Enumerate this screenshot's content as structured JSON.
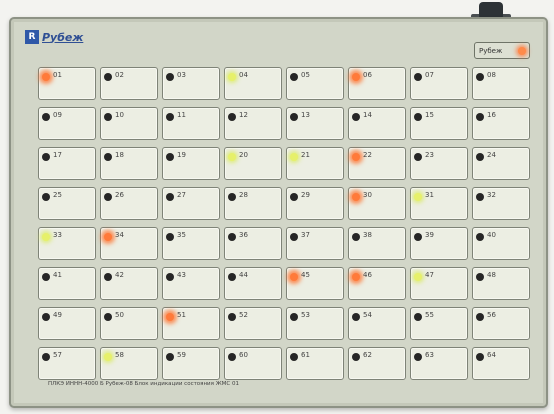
{
  "device": {
    "logo_mark": "R",
    "logo_text": "Рубеж",
    "status_label": "Рубеж",
    "footer_text": "ПЛКЭ ИННН-4000 Б Рубеж-08 Блок индикации состояния ЖМС 01"
  },
  "cells": [
    {
      "label": "01",
      "led": "orange"
    },
    {
      "label": "02",
      "led": "off"
    },
    {
      "label": "03",
      "led": "off"
    },
    {
      "label": "04",
      "led": "yellow"
    },
    {
      "label": "05",
      "led": "off"
    },
    {
      "label": "06",
      "led": "orange"
    },
    {
      "label": "07",
      "led": "off"
    },
    {
      "label": "08",
      "led": "off"
    },
    {
      "label": "09",
      "led": "off"
    },
    {
      "label": "10",
      "led": "off"
    },
    {
      "label": "11",
      "led": "off"
    },
    {
      "label": "12",
      "led": "off"
    },
    {
      "label": "13",
      "led": "off"
    },
    {
      "label": "14",
      "led": "off"
    },
    {
      "label": "15",
      "led": "off"
    },
    {
      "label": "16",
      "led": "off"
    },
    {
      "label": "17",
      "led": "off"
    },
    {
      "label": "18",
      "led": "off"
    },
    {
      "label": "19",
      "led": "off"
    },
    {
      "label": "20",
      "led": "yellow"
    },
    {
      "label": "21",
      "led": "yellow"
    },
    {
      "label": "22",
      "led": "orange"
    },
    {
      "label": "23",
      "led": "off"
    },
    {
      "label": "24",
      "led": "off"
    },
    {
      "label": "25",
      "led": "off"
    },
    {
      "label": "26",
      "led": "off"
    },
    {
      "label": "27",
      "led": "off"
    },
    {
      "label": "28",
      "led": "off"
    },
    {
      "label": "29",
      "led": "off"
    },
    {
      "label": "30",
      "led": "orange"
    },
    {
      "label": "31",
      "led": "yellow"
    },
    {
      "label": "32",
      "led": "off"
    },
    {
      "label": "33",
      "led": "yellow"
    },
    {
      "label": "34",
      "led": "orange"
    },
    {
      "label": "35",
      "led": "off"
    },
    {
      "label": "36",
      "led": "off"
    },
    {
      "label": "37",
      "led": "off"
    },
    {
      "label": "38",
      "led": "off"
    },
    {
      "label": "39",
      "led": "off"
    },
    {
      "label": "40",
      "led": "off"
    },
    {
      "label": "41",
      "led": "off"
    },
    {
      "label": "42",
      "led": "off"
    },
    {
      "label": "43",
      "led": "off"
    },
    {
      "label": "44",
      "led": "off"
    },
    {
      "label": "45",
      "led": "orange"
    },
    {
      "label": "46",
      "led": "orange"
    },
    {
      "label": "47",
      "led": "yellow"
    },
    {
      "label": "48",
      "led": "off"
    },
    {
      "label": "49",
      "led": "off"
    },
    {
      "label": "50",
      "led": "off"
    },
    {
      "label": "51",
      "led": "orange"
    },
    {
      "label": "52",
      "led": "off"
    },
    {
      "label": "53",
      "led": "off"
    },
    {
      "label": "54",
      "led": "off"
    },
    {
      "label": "55",
      "led": "off"
    },
    {
      "label": "56",
      "led": "off"
    },
    {
      "label": "57",
      "led": "off"
    },
    {
      "label": "58",
      "led": "yellow"
    },
    {
      "label": "59",
      "led": "off"
    },
    {
      "label": "60",
      "led": "off"
    },
    {
      "label": "61",
      "led": "off"
    },
    {
      "label": "62",
      "led": "off"
    },
    {
      "label": "63",
      "led": "off"
    },
    {
      "label": "64",
      "led": "off"
    }
  ],
  "colors": {
    "panel": "#d2d6c8",
    "led_active_orange": "#ff7a3a",
    "led_active_yellow": "#e6f06a",
    "led_off": "#262626"
  }
}
